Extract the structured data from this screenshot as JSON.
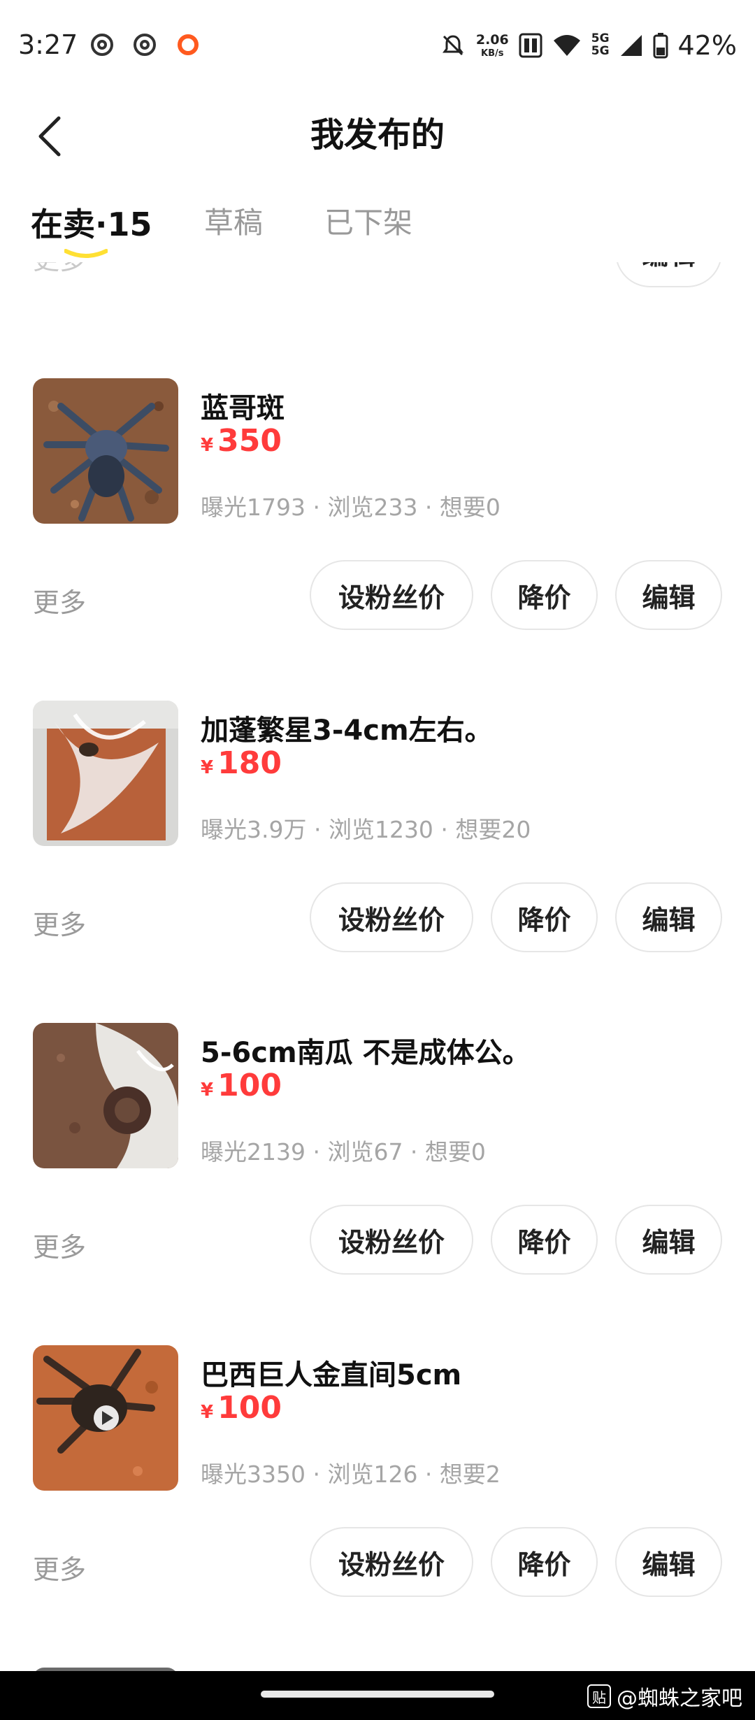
{
  "status_bar": {
    "time": "3:27",
    "net_speed_value": "2.06",
    "net_speed_unit": "KB/s",
    "signal_label_1": "5G",
    "signal_label_2": "5G",
    "battery": "42%",
    "icons": [
      "app-swirl-icon",
      "app-swirl-icon",
      "app-ring-icon",
      "bell-muted-icon",
      "hd-icon",
      "wifi-icon",
      "cell-signal-icon",
      "battery-icon"
    ]
  },
  "header": {
    "title": "我发布的",
    "back_icon": "chevron-left-icon"
  },
  "tabs": [
    {
      "label": "在卖·15",
      "active": true
    },
    {
      "label": "草稿",
      "active": false
    },
    {
      "label": "已下架",
      "active": false
    }
  ],
  "partial_top": {
    "more_label": "更多",
    "edit_label": "编辑"
  },
  "items": [
    {
      "title": "蓝哥斑",
      "currency": "¥",
      "price": "350",
      "stats": "曝光1793 · 浏览233 · 想要0",
      "more": "更多",
      "btn_fans": "设粉丝价",
      "btn_reduce": "降价",
      "btn_edit": "编辑",
      "has_video": false
    },
    {
      "title": "加蓬繁星3-4cm左右。",
      "currency": "¥",
      "price": "180",
      "stats": "曝光3.9万 · 浏览1230 · 想要20",
      "more": "更多",
      "btn_fans": "设粉丝价",
      "btn_reduce": "降价",
      "btn_edit": "编辑",
      "has_video": false
    },
    {
      "title": "5-6cm南瓜 不是成体公。",
      "currency": "¥",
      "price": "100",
      "stats": "曝光2139 · 浏览67 · 想要0",
      "more": "更多",
      "btn_fans": "设粉丝价",
      "btn_reduce": "降价",
      "btn_edit": "编辑",
      "has_video": false
    },
    {
      "title": "巴西巨人金直间5cm",
      "currency": "¥",
      "price": "100",
      "stats": "曝光3350 · 浏览126 · 想要2",
      "more": "更多",
      "btn_fans": "设粉丝价",
      "btn_reduce": "降价",
      "btn_edit": "编辑",
      "has_video": true
    }
  ],
  "colors": {
    "price": "#ff3b3b",
    "tab_underline": "#ffe033",
    "muted_text": "#a5a5a5"
  },
  "watermark": {
    "icon_text": "贴",
    "text": "@蜘蛛之家吧"
  }
}
